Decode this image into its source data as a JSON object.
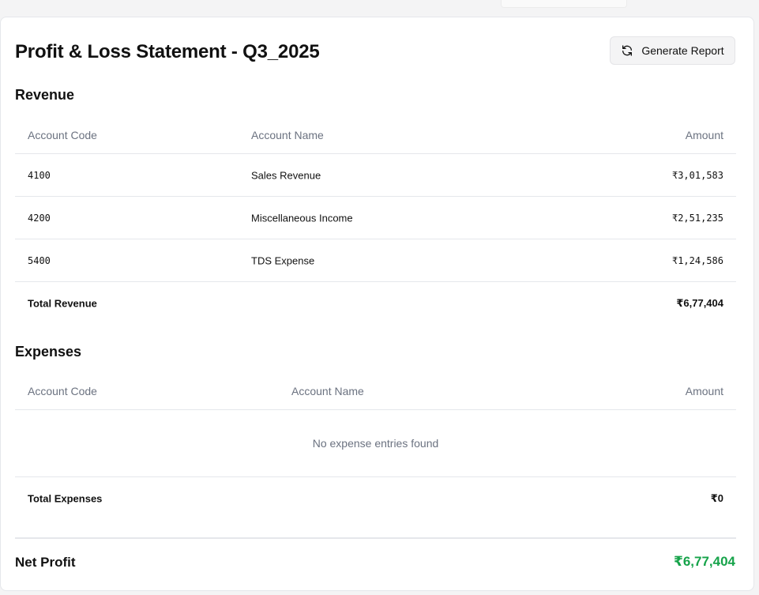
{
  "page": {
    "title": "Profit & Loss Statement - Q3_2025",
    "generate_button": "Generate Report"
  },
  "revenue": {
    "section_title": "Revenue",
    "headers": {
      "code": "Account Code",
      "name": "Account Name",
      "amount": "Amount"
    },
    "rows": [
      {
        "code": "4100",
        "name": "Sales Revenue",
        "amount": "₹3,01,583"
      },
      {
        "code": "4200",
        "name": "Miscellaneous Income",
        "amount": "₹2,51,235"
      },
      {
        "code": "5400",
        "name": "TDS Expense",
        "amount": "₹1,24,586"
      }
    ],
    "total_label": "Total Revenue",
    "total_value": "₹6,77,404"
  },
  "expenses": {
    "section_title": "Expenses",
    "headers": {
      "code": "Account Code",
      "name": "Account Name",
      "amount": "Amount"
    },
    "empty_message": "No expense entries found",
    "total_label": "Total Expenses",
    "total_value": "₹0"
  },
  "net_profit": {
    "label": "Net Profit",
    "value": "₹6,77,404",
    "color": "#16a34a"
  },
  "icons": {
    "generate_button_icon": "refresh-icon"
  }
}
